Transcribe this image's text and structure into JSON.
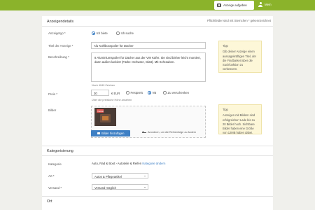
{
  "topbar": {
    "post_label": "Anzeige aufgeben",
    "user_label": "Mein"
  },
  "details": {
    "title": "Anzeigendetails",
    "required_note": "Pflichtfelder sind mit Sternchen * gekennzeichnet",
    "type_label": "Anzeigetyp *",
    "type_options": [
      "Ich biete",
      "Ich suche"
    ],
    "title_label": "Titel der Anzeige *",
    "title_value": "Alu Kühlboxspoiler für Dächer",
    "desc_label": "Beschreibung *",
    "desc_value": "8 Aluminiumspoiler für Dächer aus der VW Käfer. Sie sind bisher leicht montiert, dann außen lackiert (Farbe: Schwarz, Glatt). Mit Schrauben.",
    "desc_hint": "Noch 4040 Zeichen",
    "price_label": "Preis *",
    "price_value": "30",
    "price_currency": "€ EUR",
    "price_options": [
      "Festpreis",
      "VB",
      "Zu verschenken"
    ],
    "price_hint": "Über die preisliche Höhe ansehen",
    "images_label": "Bilder",
    "add_image_label": "Bilder hinzufügen",
    "drag_hint": "Anordnen, um die Reihenfolge zu ändern",
    "thumb_badge": "Titelbild",
    "tip1_title": "Tipp",
    "tip1_text": "Gib deiner Anzeige einen aussagekräftigen Titel, der die Findbarkeit über die Suchfunktion zu verbessern.",
    "tip2_title": "Tipp",
    "tip2_text": "Anzeigen mit Bildern sind erfolgreicher! Lade bis zu 20 Bilder hoch. Sichtbare Bilder haben eine Größe von 12MB haben dabei."
  },
  "category": {
    "title": "Kategorisierung",
    "cat_label": "Kategorie",
    "cat_value": "Auto, Rad & Boot › Autoteile & Reifen",
    "cat_change": "Kategorie ändern",
    "art_label": "Art *",
    "art_value": "Autos & Pflegeartikel",
    "ship_label": "Versand *",
    "ship_value": "Versand möglich"
  },
  "location": {
    "title": "Ort"
  }
}
